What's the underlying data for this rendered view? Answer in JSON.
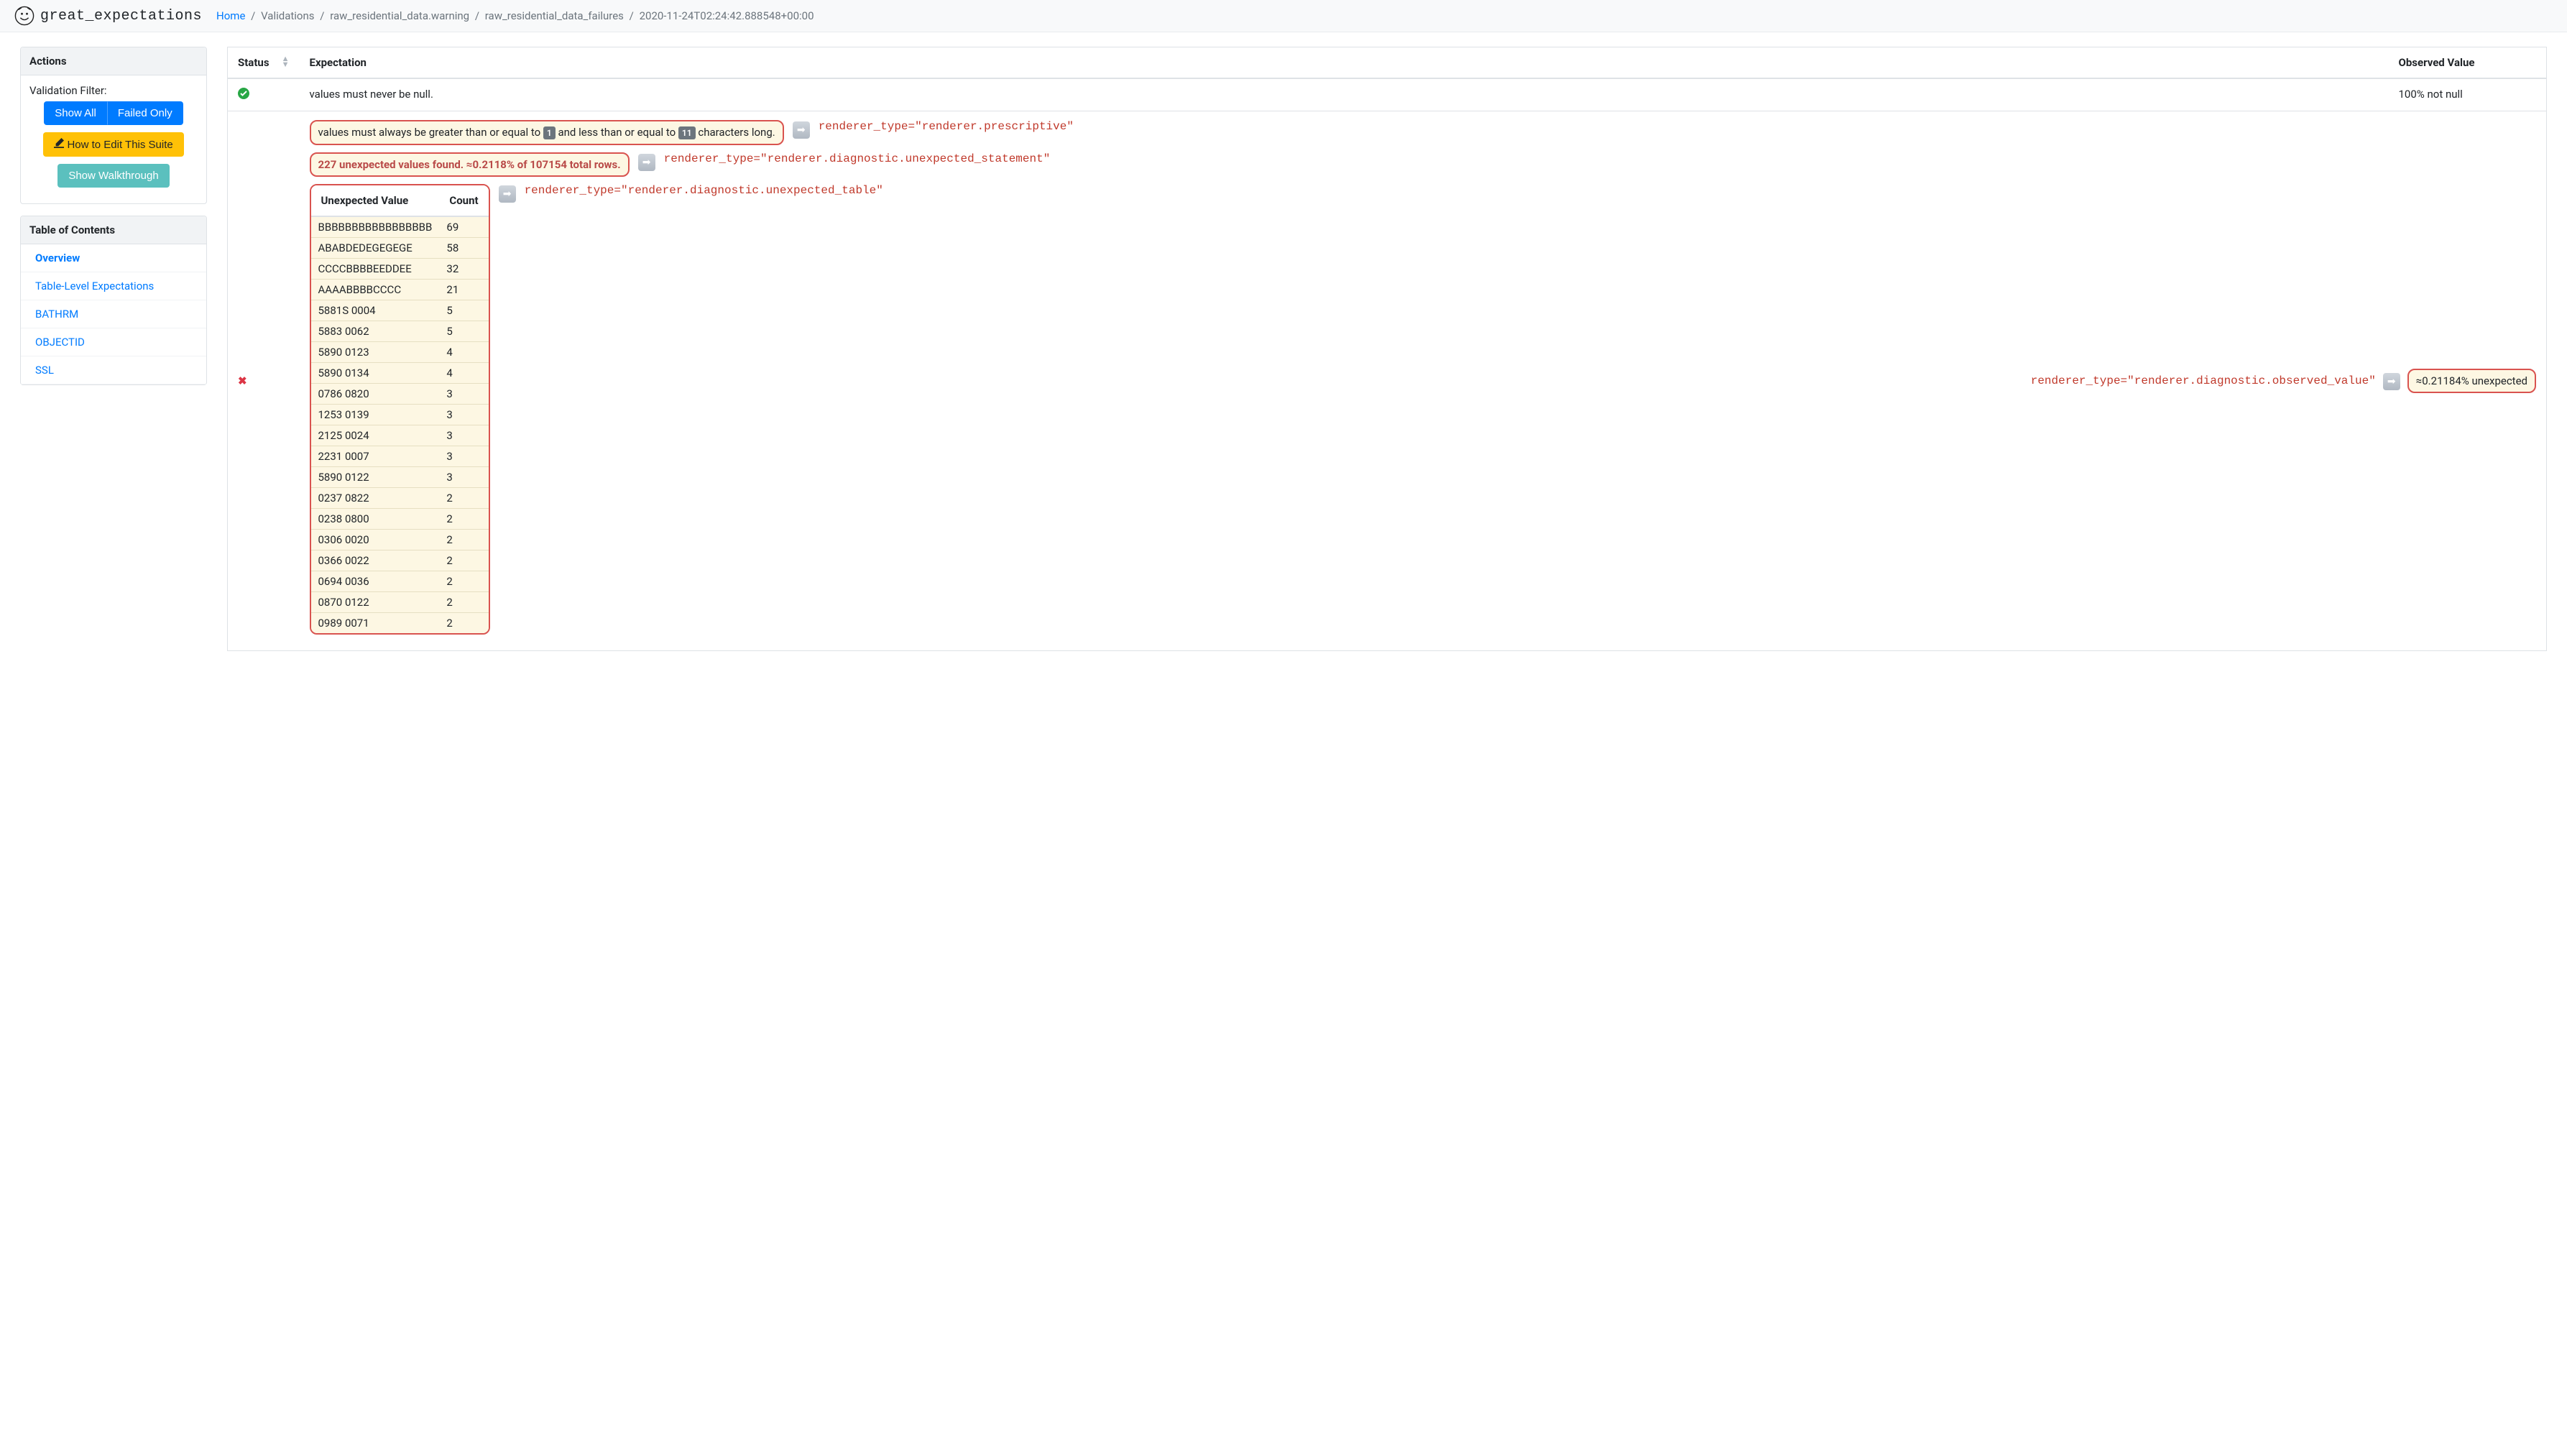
{
  "brand": "great_expectations",
  "breadcrumb": {
    "home": "Home",
    "parts": [
      "Validations",
      "raw_residential_data.warning",
      "raw_residential_data_failures",
      "2020-11-24T02:24:42.888548+00:00"
    ]
  },
  "sidebar": {
    "actions_title": "Actions",
    "filter_label": "Validation Filter:",
    "show_all": "Show All",
    "failed_only": "Failed Only",
    "edit_suite": "How to Edit This Suite",
    "walkthrough": "Show Walkthrough",
    "toc_title": "Table of Contents",
    "toc": [
      {
        "label": "Overview",
        "active": true
      },
      {
        "label": "Table-Level Expectations",
        "active": false
      },
      {
        "label": "BATHRM",
        "active": false
      },
      {
        "label": "OBJECTID",
        "active": false
      },
      {
        "label": "SSL",
        "active": false
      }
    ]
  },
  "table": {
    "headers": {
      "status": "Status",
      "expectation": "Expectation",
      "observed": "Observed Value"
    },
    "row_pass": {
      "expectation": "values must never be null.",
      "observed": "100% not null"
    },
    "row_fail": {
      "prescriptive_pre": "values must always be greater than or equal to ",
      "prescriptive_badge1": "1",
      "prescriptive_mid": " and less than or equal to ",
      "prescriptive_badge2": "11",
      "prescriptive_post": " characters long.",
      "renderer_prescriptive": "renderer_type=\"renderer.prescriptive\"",
      "unexpected_stmt": "227 unexpected values found. ≈0.2118% of 107154 total rows.",
      "renderer_unexpected_stmt": "renderer_type=\"renderer.diagnostic.unexpected_statement\"",
      "renderer_unexpected_table": "renderer_type=\"renderer.diagnostic.unexpected_table\"",
      "renderer_observed": "renderer_type=\"renderer.diagnostic.observed_value\"",
      "observed": "≈0.21184% unexpected",
      "inner_headers": {
        "value": "Unexpected Value",
        "count": "Count"
      },
      "inner_rows": [
        {
          "v": "BBBBBBBBBBBBBBBBB",
          "c": "69"
        },
        {
          "v": "ABABDEDEGEGEGE",
          "c": "58"
        },
        {
          "v": "CCCCBBBBEEDDEE",
          "c": "32"
        },
        {
          "v": "AAAABBBBCCCC",
          "c": "21"
        },
        {
          "v": "5881S 0004",
          "c": "5"
        },
        {
          "v": "5883 0062",
          "c": "5"
        },
        {
          "v": "5890 0123",
          "c": "4"
        },
        {
          "v": "5890 0134",
          "c": "4"
        },
        {
          "v": "0786 0820",
          "c": "3"
        },
        {
          "v": "1253 0139",
          "c": "3"
        },
        {
          "v": "2125 0024",
          "c": "3"
        },
        {
          "v": "2231 0007",
          "c": "3"
        },
        {
          "v": "5890 0122",
          "c": "3"
        },
        {
          "v": "0237 0822",
          "c": "2"
        },
        {
          "v": "0238 0800",
          "c": "2"
        },
        {
          "v": "0306 0020",
          "c": "2"
        },
        {
          "v": "0366 0022",
          "c": "2"
        },
        {
          "v": "0694 0036",
          "c": "2"
        },
        {
          "v": "0870 0122",
          "c": "2"
        },
        {
          "v": "0989 0071",
          "c": "2"
        }
      ]
    }
  }
}
